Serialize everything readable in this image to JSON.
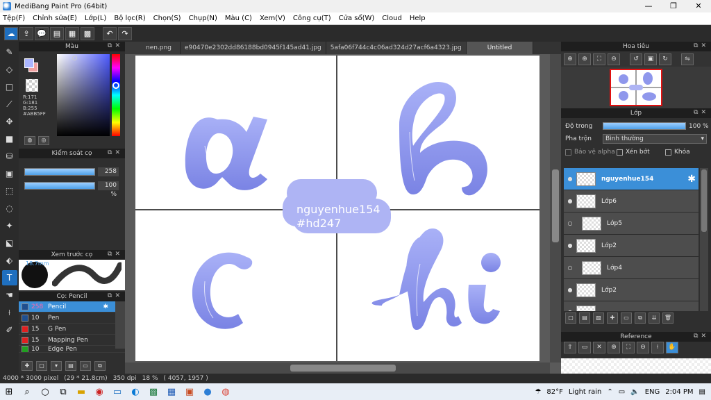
{
  "window": {
    "title": "MediBang Paint Pro (64bit)"
  },
  "menu": [
    "Tệp(F)",
    "Chỉnh sửa(E)",
    "Lớp(L)",
    "Bộ lọc(R)",
    "Chọn(S)",
    "Chụp(N)",
    "Màu (C)",
    "Xem(V)",
    "Công cụ(T)",
    "Cửa sổ(W)",
    "Cloud",
    "Help"
  ],
  "color_panel": {
    "title": "Màu",
    "r": "R:171",
    "g": "G:181",
    "b": "B:255",
    "hex": "#ABB5FF",
    "fg_color": "#abb5ff"
  },
  "brush_control": {
    "title": "Kiểm soát cọ",
    "size_value": "258",
    "opacity_value": "100 %",
    "opacity": 1.0
  },
  "brush_preview": {
    "title": "Xem trước cọ",
    "size_label": "18.7mm"
  },
  "brush_list": {
    "title": "Cọ: Pencil",
    "items": [
      {
        "size": "258",
        "name": "Pencil",
        "color": "#1f4f8f"
      },
      {
        "size": "10",
        "name": "Pen",
        "color": "#1f4f8f"
      },
      {
        "size": "15",
        "name": "G Pen",
        "color": "#e02020"
      },
      {
        "size": "15",
        "name": "Mapping Pen",
        "color": "#e02020"
      },
      {
        "size": "10",
        "name": "Edge Pen",
        "color": "#20a020"
      }
    ]
  },
  "tabs": [
    "nen.png",
    "e90470e2302dd86188bd0945f145ad41.jpg",
    "5afa06f744c4c06ad324d27acf6a4323.jpg",
    "Untitled"
  ],
  "canvas": {
    "watermark_line1": "nguyenhue154",
    "watermark_line2": "#hd247"
  },
  "navigator": {
    "title": "Hoa tiêu"
  },
  "layer_panel": {
    "title": "Lớp",
    "opacity_label": "Độ trong",
    "opacity_value": "100 %",
    "blend_label": "Pha trộn",
    "blend_value": "Bình thường",
    "protect_alpha": "Bảo vệ alpha",
    "clipping": "Xén bớt",
    "lock": "Khóa",
    "layers": [
      {
        "name": "nguyenhue154",
        "active": true,
        "indent": false
      },
      {
        "name": "Lớp6",
        "active": false,
        "indent": false
      },
      {
        "name": "Lớp5",
        "active": false,
        "indent": true
      },
      {
        "name": "Lớp2",
        "active": false,
        "indent": false
      },
      {
        "name": "Lớp4",
        "active": false,
        "indent": true
      },
      {
        "name": "Lớp2",
        "active": false,
        "indent": false
      },
      {
        "name": "",
        "active": false,
        "indent": false
      }
    ]
  },
  "reference": {
    "title": "Reference"
  },
  "status": {
    "size": "4000 * 3000 pixel",
    "dimension": "(29 * 21.8cm)",
    "dpi": "350 dpi",
    "zoom": "18 %",
    "coords": "( 4057, 1957 )"
  },
  "taskbar": {
    "weather_temp": "82°F",
    "weather_desc": "Light rain",
    "lang": "ENG",
    "time": "2:04 PM"
  },
  "colors": {
    "accent": "#3b8fd8",
    "letter_fill": "#8f97ec"
  }
}
